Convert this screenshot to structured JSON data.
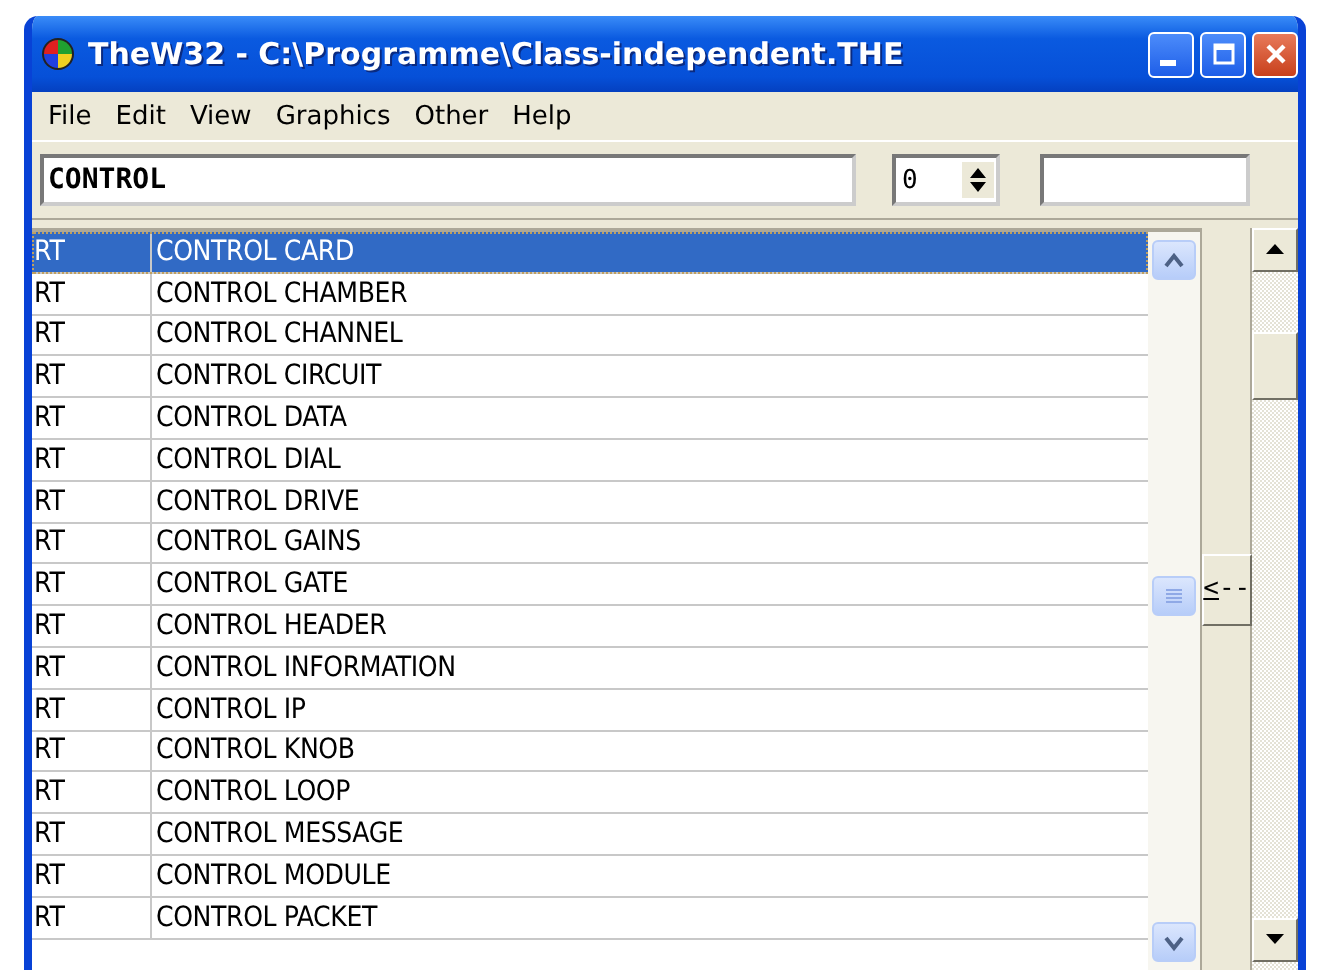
{
  "window": {
    "title": "TheW32 - C:\\Programme\\Class-independent.THE"
  },
  "menu": [
    "File",
    "Edit",
    "View",
    "Graphics",
    "Other",
    "Help"
  ],
  "toolbar": {
    "search_value": "CONTROL",
    "spin_value": "0"
  },
  "list": {
    "rows": [
      {
        "column_1": "RT",
        "column_2": "CONTROL CARD",
        "selected": true
      },
      {
        "column_1": "RT",
        "column_2": "CONTROL CHAMBER",
        "selected": false
      },
      {
        "column_1": "RT",
        "column_2": "CONTROL CHANNEL",
        "selected": false
      },
      {
        "column_1": "RT",
        "column_2": "CONTROL CIRCUIT",
        "selected": false
      },
      {
        "column_1": "RT",
        "column_2": "CONTROL DATA",
        "selected": false
      },
      {
        "column_1": "RT",
        "column_2": "CONTROL DIAL",
        "selected": false
      },
      {
        "column_1": "RT",
        "column_2": "CONTROL DRIVE",
        "selected": false
      },
      {
        "column_1": "RT",
        "column_2": "CONTROL GAINS",
        "selected": false
      },
      {
        "column_1": "RT",
        "column_2": "CONTROL GATE",
        "selected": false
      },
      {
        "column_1": "RT",
        "column_2": "CONTROL HEADER",
        "selected": false
      },
      {
        "column_1": "RT",
        "column_2": "CONTROL INFORMATION",
        "selected": false
      },
      {
        "column_1": "RT",
        "column_2": "CONTROL IP",
        "selected": false
      },
      {
        "column_1": "RT",
        "column_2": "CONTROL KNOB",
        "selected": false
      },
      {
        "column_1": "RT",
        "column_2": "CONTROL LOOP",
        "selected": false
      },
      {
        "column_1": "RT",
        "column_2": "CONTROL MESSAGE",
        "selected": false
      },
      {
        "column_1": "RT",
        "column_2": "CONTROL MODULE",
        "selected": false
      },
      {
        "column_1": "RT",
        "column_2": "CONTROL PACKET",
        "selected": false
      }
    ]
  },
  "side_button": "<--"
}
